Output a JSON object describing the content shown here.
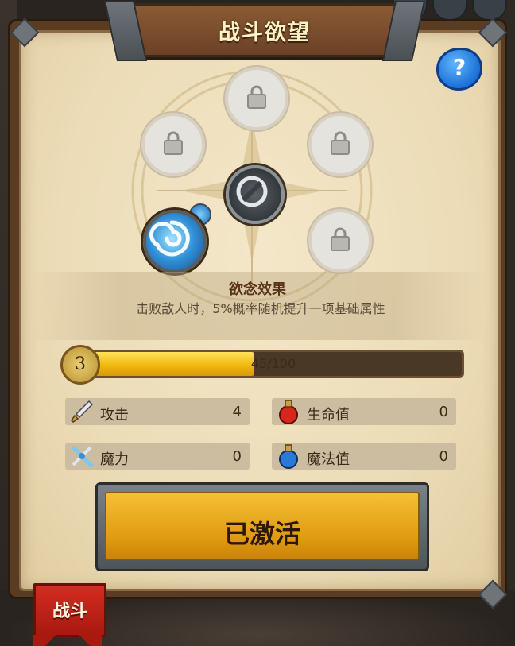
{
  "title": "战斗欲望",
  "help_button": "?",
  "effect": {
    "title": "欲念效果",
    "description": "击败敌人时，5%概率随机提升一项基础属性"
  },
  "level": {
    "value": "3",
    "progress_text": "45/100",
    "progress_fraction": 0.45
  },
  "stats": [
    {
      "label": "攻击",
      "value": "4",
      "icon": "sword-icon"
    },
    {
      "label": "生命值",
      "value": "0",
      "icon": "red-potion-icon"
    },
    {
      "label": "魔力",
      "value": "0",
      "icon": "magic-sword-icon"
    },
    {
      "label": "魔法值",
      "value": "0",
      "icon": "blue-potion-icon"
    }
  ],
  "activate_button": "已激活",
  "bottom_tab": "战斗",
  "colors": {
    "button_gold": "#f0b018",
    "tab_red": "#c0221a",
    "help_blue": "#1f78dc",
    "parchment": "#ecdcb7"
  }
}
